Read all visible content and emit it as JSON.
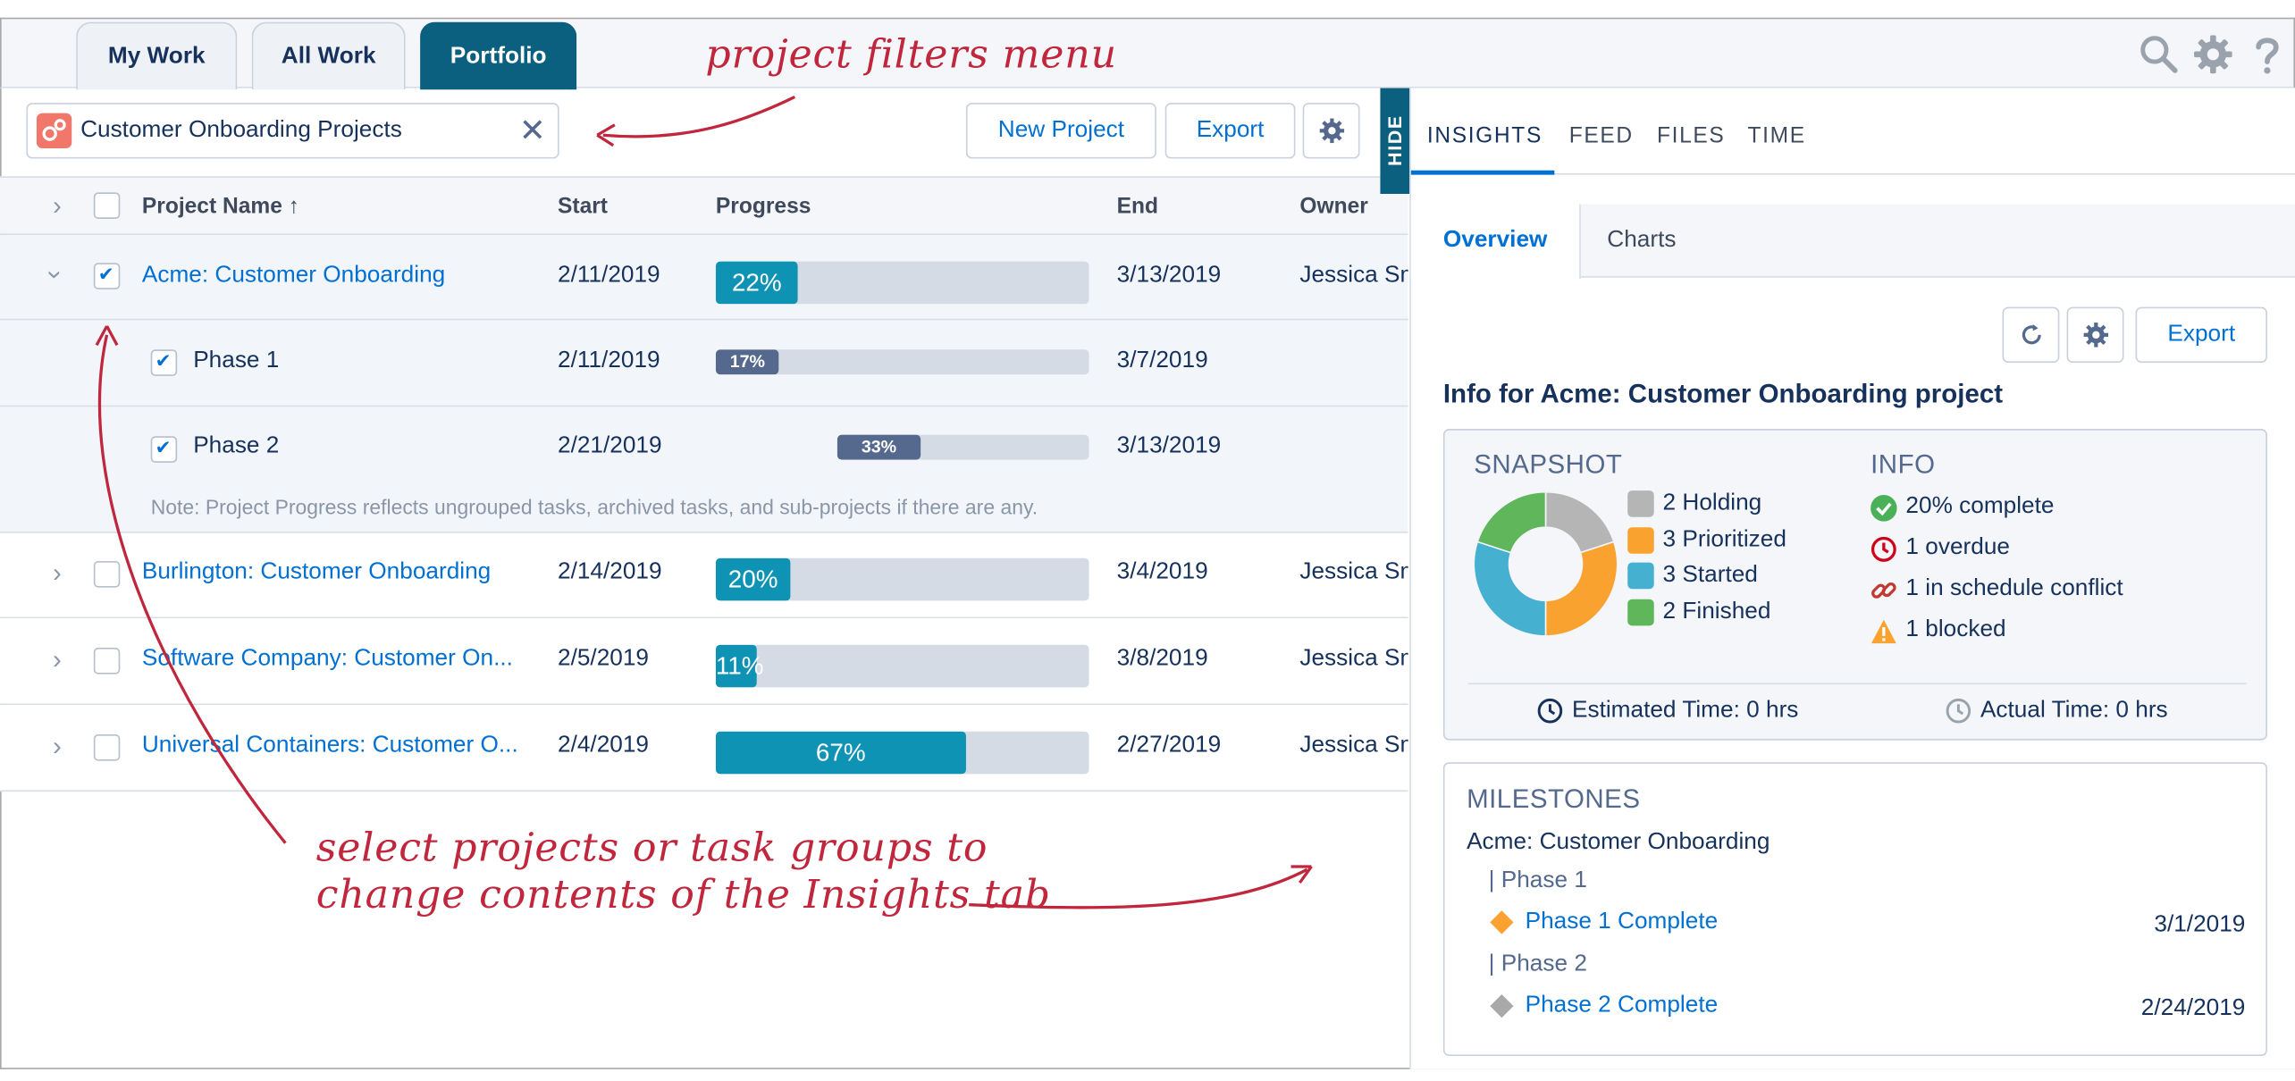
{
  "tabs": [
    {
      "label": "My Work"
    },
    {
      "label": "All Work"
    },
    {
      "label": "Portfolio",
      "active": true
    }
  ],
  "toolbar": {
    "filter_value": "Customer Onboarding Projects",
    "clear_glyph": "✕",
    "new_project_label": "New Project",
    "export_label": "Export",
    "hide_label": "HIDE"
  },
  "columns": [
    "Project Name",
    "Start",
    "Progress",
    "End",
    "Owner"
  ],
  "sort_glyph": "↑",
  "rows": [
    {
      "name": "Acme: Customer Onboarding",
      "start": "2/11/2019",
      "progress": 22,
      "progress_label": "22%",
      "end": "3/13/2019",
      "owner": "Jessica Sm"
    },
    {
      "name": "Phase 1",
      "start": "2/11/2019",
      "progress": 17,
      "progress_label": "17%",
      "end": "3/7/2019"
    },
    {
      "name": "Phase 2",
      "start": "2/21/2019",
      "progress": 33,
      "progress_label": "33%",
      "end": "3/13/2019"
    },
    {
      "name": "Burlington: Customer Onboarding",
      "start": "2/14/2019",
      "progress": 20,
      "progress_label": "20%",
      "end": "3/4/2019",
      "owner": "Jessica Sm"
    },
    {
      "name": "Software Company: Customer On...",
      "start": "2/5/2019",
      "progress": 11,
      "progress_label": "11%",
      "end": "3/8/2019",
      "owner": "Jessica Sm"
    },
    {
      "name": "Universal Containers: Customer O...",
      "start": "2/4/2019",
      "progress": 67,
      "progress_label": "67%",
      "end": "2/27/2019",
      "owner": "Jessica Sm"
    }
  ],
  "note": "Note: Project Progress reflects ungrouped tasks, archived tasks, and sub-projects if there are any.",
  "panel": {
    "tabs": [
      "INSIGHTS",
      "FEED",
      "FILES",
      "TIME"
    ],
    "subtabs": [
      "Overview",
      "Charts"
    ],
    "export_label": "Export",
    "info_title": "Info for Acme: Customer Onboarding project",
    "snapshot_title": "SNAPSHOT",
    "info_heading": "INFO",
    "snapshot": [
      {
        "label": "2 Holding",
        "count": 2,
        "color": "#b5b5b5"
      },
      {
        "label": "3 Prioritized",
        "count": 3,
        "color": "#f9a22f"
      },
      {
        "label": "3 Started",
        "count": 3,
        "color": "#46b0d0"
      },
      {
        "label": "2 Finished",
        "count": 2,
        "color": "#5fb65b"
      }
    ],
    "info": [
      {
        "label": "20% complete",
        "icon": "check-circle-icon"
      },
      {
        "label": "1 overdue",
        "icon": "clock-icon"
      },
      {
        "label": "1 in schedule conflict",
        "icon": "link-icon"
      },
      {
        "label": "1 blocked",
        "icon": "warning-icon"
      }
    ],
    "estimated": "Estimated Time: 0 hrs",
    "actual": "Actual Time: 0 hrs",
    "milestones": {
      "title": "MILESTONES",
      "project": "Acme: Customer Onboarding",
      "groups": [
        {
          "name": "Phase 1",
          "milestone": "Phase 1 Complete",
          "date": "3/1/2019",
          "color": "#f9a22f"
        },
        {
          "name": "Phase 2",
          "milestone": "Phase 2 Complete",
          "date": "2/24/2019",
          "color": "#a9a9a9"
        }
      ]
    }
  },
  "annotations": {
    "filters": "project filters menu",
    "select_line1": "select projects or task groups to",
    "select_line2": "change contents of the Insights tab"
  }
}
